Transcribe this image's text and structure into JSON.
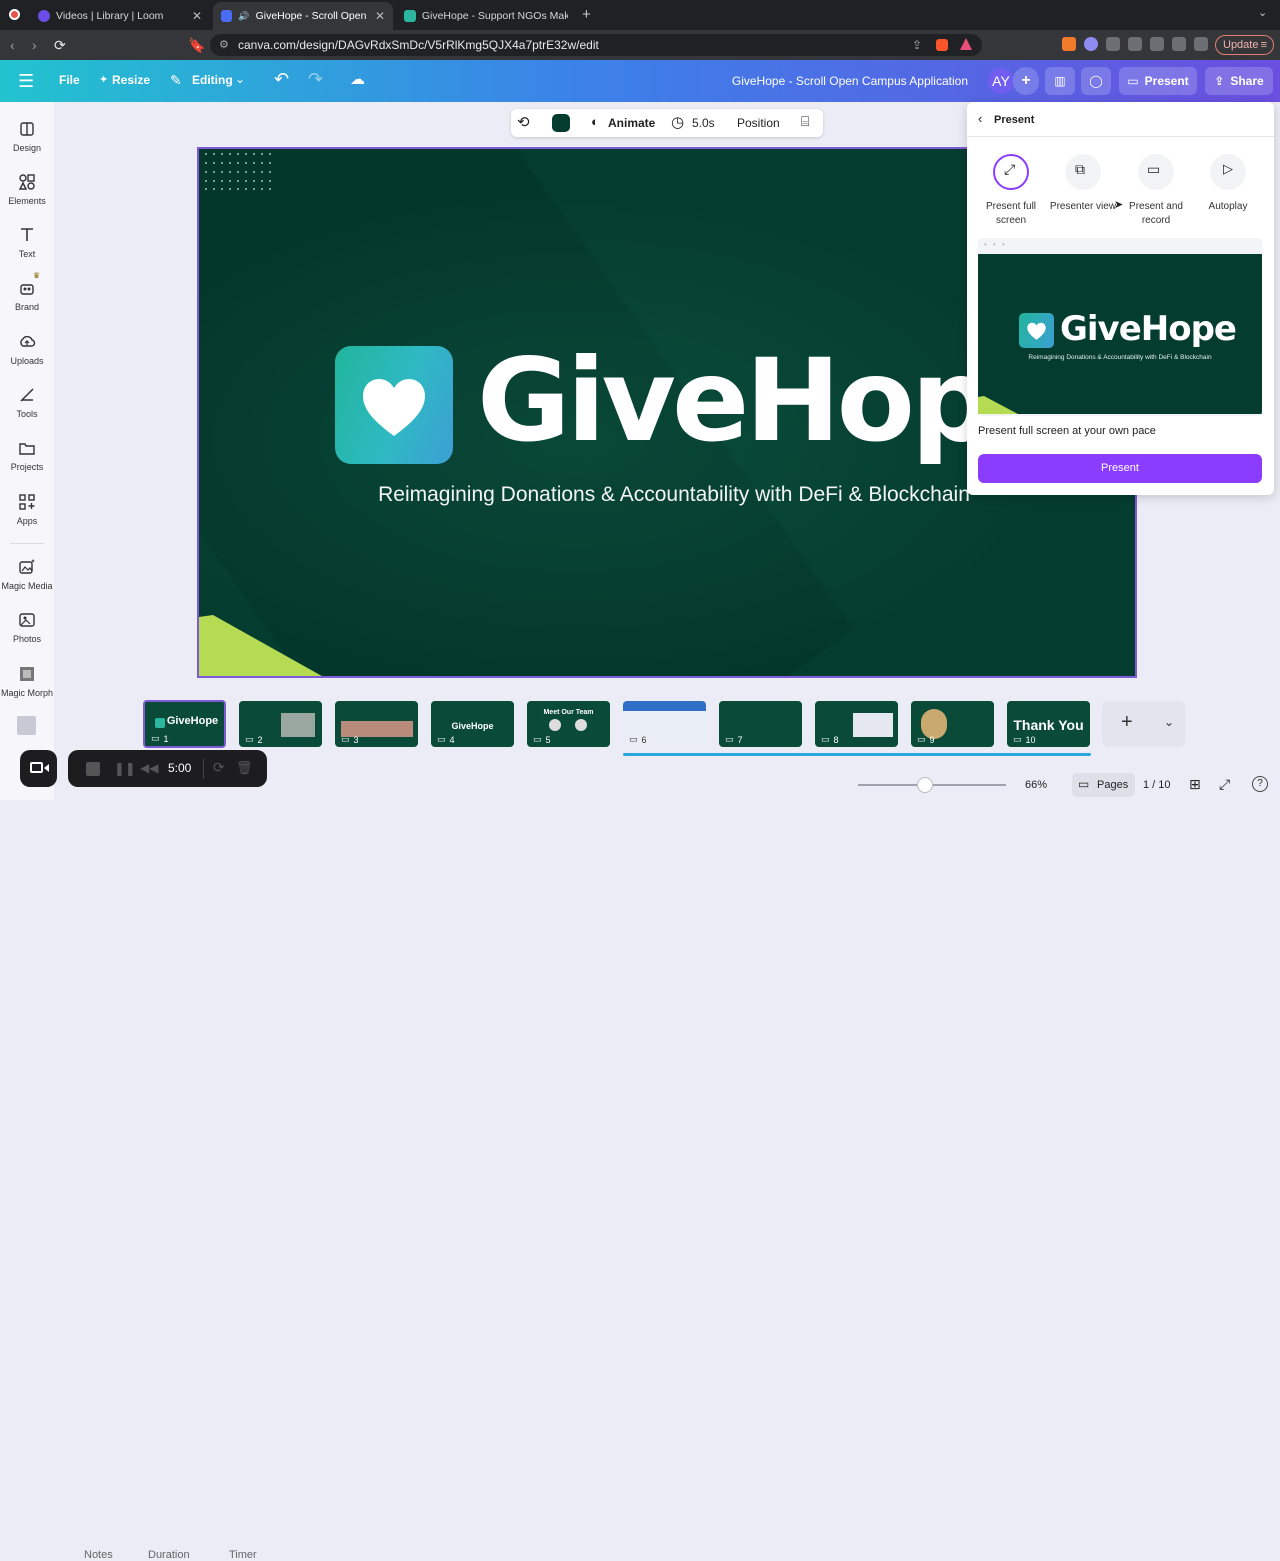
{
  "browser": {
    "tabs": [
      {
        "title": "Videos | Library | Loom",
        "active": false
      },
      {
        "title": "GiveHope - Scroll Open Ca",
        "active": true
      },
      {
        "title": "GiveHope - Support NGOs Making",
        "active": false
      }
    ],
    "url": "canva.com/design/DAGvRdxSmDc/V5rRlKmg5QJX4a7ptrE32w/edit",
    "update_label": "Update"
  },
  "header": {
    "file_label": "File",
    "resize_label": "Resize",
    "editing_label": "Editing",
    "doc_title": "GiveHope - Scroll Open Campus Application",
    "avatar_initials": "AY",
    "present_label": "Present",
    "share_label": "Share",
    "accent": "#8b3dff"
  },
  "sidebar": {
    "items": [
      {
        "label": "Design",
        "icon": "design-icon"
      },
      {
        "label": "Elements",
        "icon": "elements-icon"
      },
      {
        "label": "Text",
        "icon": "text-icon"
      },
      {
        "label": "Brand",
        "icon": "brand-icon"
      },
      {
        "label": "Uploads",
        "icon": "uploads-icon"
      },
      {
        "label": "Tools",
        "icon": "tools-icon"
      },
      {
        "label": "Projects",
        "icon": "projects-icon"
      },
      {
        "label": "Apps",
        "icon": "apps-icon"
      },
      {
        "label": "Magic Media",
        "icon": "magic-media-icon"
      },
      {
        "label": "Photos",
        "icon": "photos-icon"
      },
      {
        "label": "Magic Morph",
        "icon": "magic-morph-icon"
      }
    ]
  },
  "toolbar": {
    "animate_label": "Animate",
    "duration_label": "5.0s",
    "position_label": "Position",
    "color": "#053c30"
  },
  "slide": {
    "brand": "GiveHope",
    "tagline": "Reimagining Donations & Accountability with DeFi & Blockchain",
    "background": "#053c30",
    "accent_green": "#b5db52"
  },
  "present_panel": {
    "title": "Present",
    "options": [
      {
        "label": "Present full screen",
        "icon": "expand-icon",
        "selected": true
      },
      {
        "label": "Presenter view",
        "icon": "presenter-view-icon",
        "selected": false
      },
      {
        "label": "Present and record",
        "icon": "camera-icon",
        "selected": false
      },
      {
        "label": "Autoplay",
        "icon": "play-icon",
        "selected": false
      }
    ],
    "preview_brand": "GiveHope",
    "preview_tagline": "Reimagining Donations & Accountability with DeFi & Blockchain",
    "description": "Present full screen at your own pace",
    "button_label": "Present"
  },
  "pages": {
    "thumbnails": [
      {
        "number": "1",
        "title": "GiveHope"
      },
      {
        "number": "2",
        "title": ""
      },
      {
        "number": "3",
        "title": ""
      },
      {
        "number": "4",
        "title": "GiveHope"
      },
      {
        "number": "5",
        "title": "Meet Our Team"
      },
      {
        "number": "6",
        "title": ""
      },
      {
        "number": "7",
        "title": ""
      },
      {
        "number": "8",
        "title": ""
      },
      {
        "number": "9",
        "title": ""
      },
      {
        "number": "10",
        "title": "Thank You"
      }
    ],
    "add_label": "+"
  },
  "footer": {
    "zoom": "66%",
    "zoom_level": 0.45,
    "pages_label": "Pages",
    "page_counter": "1 / 10",
    "notes_label": "Notes",
    "duration_label": "Duration",
    "timer_label": "Timer"
  },
  "recorder": {
    "time": "5:00"
  }
}
